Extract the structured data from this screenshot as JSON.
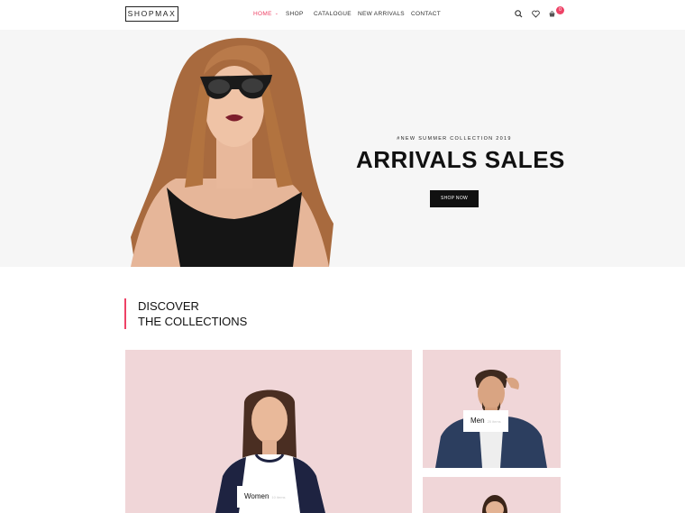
{
  "brand": {
    "logo": "SHOPMAX",
    "accent": "#ee4266"
  },
  "nav": {
    "items": [
      {
        "label": "HOME",
        "active": true,
        "has_dropdown": true
      },
      {
        "label": "SHOP",
        "active": false
      },
      {
        "label": "CATALOGUE",
        "active": false
      },
      {
        "label": "NEW ARRIVALS",
        "active": false
      },
      {
        "label": "CONTACT",
        "active": false
      }
    ],
    "icons": [
      "search-icon",
      "heart-icon",
      "cart-icon"
    ],
    "cart_count": "0"
  },
  "hero": {
    "subtitle": "#NEW SUMMER COLLECTION 2019",
    "title": "ARRIVALS SALES",
    "button_label": "SHOP NOW"
  },
  "discover": {
    "line1": "DISCOVER",
    "line2": "THE COLLECTIONS"
  },
  "collections": [
    {
      "label": "Women",
      "count": "10 items"
    },
    {
      "label": "Men",
      "count": "25 items"
    }
  ]
}
